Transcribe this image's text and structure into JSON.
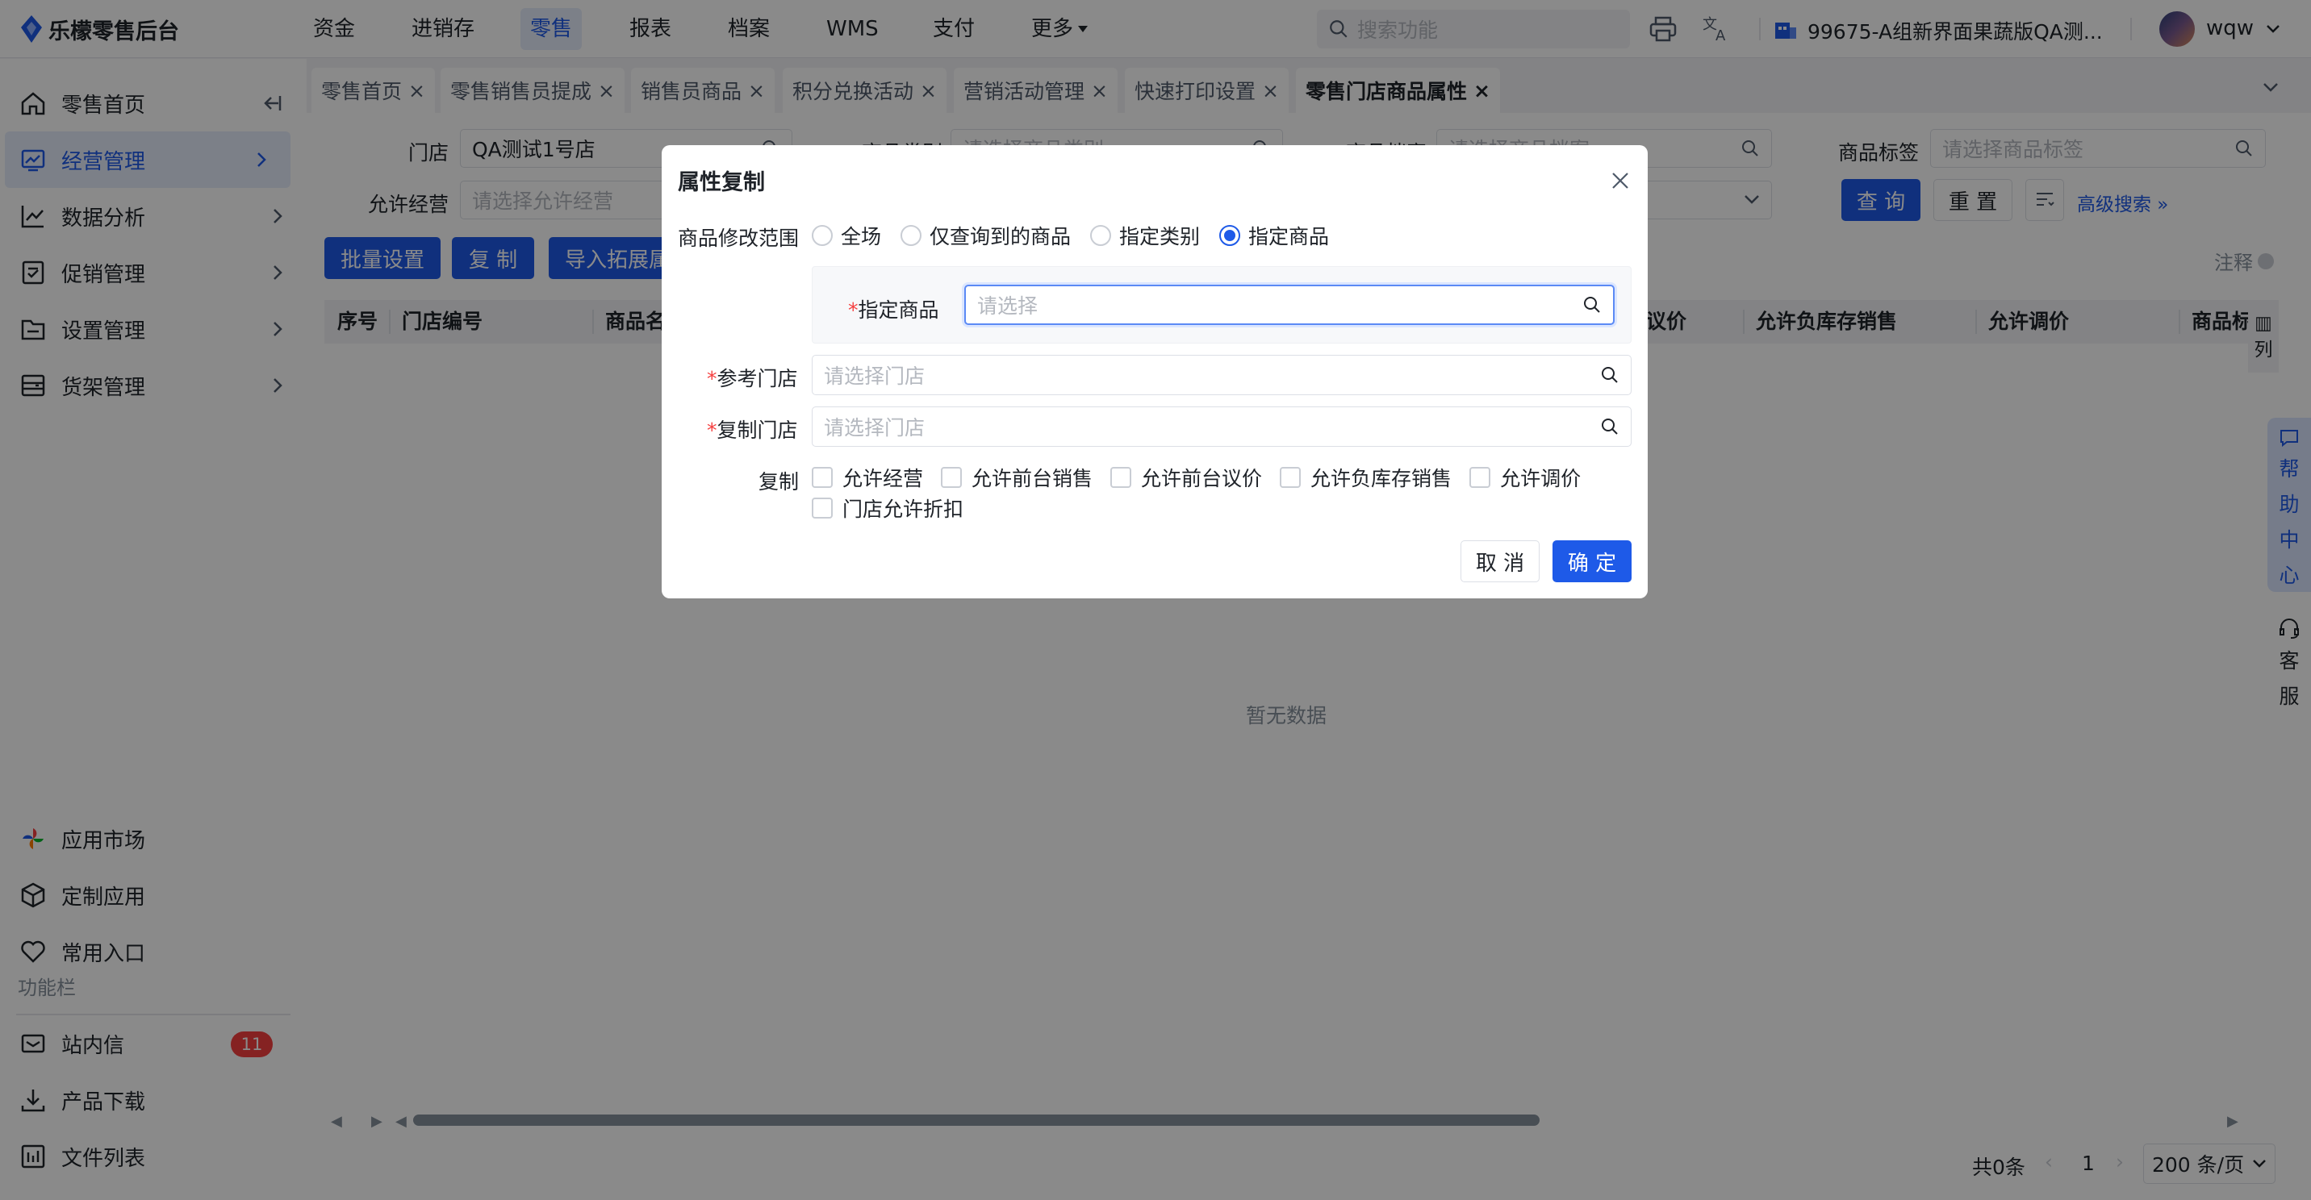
{
  "app": {
    "logo_text": "乐檬零售后台"
  },
  "topnav": {
    "items": [
      "资金",
      "进销存",
      "零售",
      "报表",
      "档案",
      "WMS",
      "支付",
      "更多"
    ],
    "active": "零售",
    "search_placeholder": "搜索功能",
    "store_name": "99675-A组新界面果蔬版QA测...",
    "username": "wqw"
  },
  "sidebar": {
    "items": [
      {
        "label": "零售首页",
        "icon": "home-icon"
      },
      {
        "label": "经营管理",
        "icon": "chart-board-icon"
      },
      {
        "label": "数据分析",
        "icon": "line-chart-icon"
      },
      {
        "label": "促销管理",
        "icon": "promotion-icon"
      },
      {
        "label": "设置管理",
        "icon": "folder-icon"
      },
      {
        "label": "货架管理",
        "icon": "shelf-icon"
      }
    ],
    "bottom_items": [
      {
        "label": "应用市场",
        "icon": "app-market-icon"
      },
      {
        "label": "定制应用",
        "icon": "cube-icon"
      },
      {
        "label": "常用入口",
        "icon": "heart-icon"
      }
    ],
    "section_label": "功能栏",
    "func_items": [
      {
        "label": "站内信",
        "icon": "mail-icon",
        "badge": "11"
      },
      {
        "label": "产品下载",
        "icon": "download-icon"
      },
      {
        "label": "文件列表",
        "icon": "file-list-icon"
      }
    ]
  },
  "tabs": [
    "零售首页",
    "零售销售员提成",
    "销售员商品",
    "积分兑换活动",
    "营销活动管理",
    "快速打印设置",
    "零售门店商品属性"
  ],
  "filters": {
    "store_label": "门店",
    "store_value": "QA测试1号店",
    "category_label": "商品类别",
    "category_placeholder": "请选择商品类别",
    "archive_label": "商品档案",
    "archive_placeholder": "请选择商品档案",
    "tag_label": "商品标签",
    "tag_placeholder": "请选择商品标签",
    "allow_label": "允许经营",
    "allow_placeholder": "请选择允许经营",
    "query_btn": "查 询",
    "reset_btn": "重 置",
    "advanced": "高级搜索"
  },
  "actions": {
    "batch": "批量设置",
    "copy": "复 制",
    "import": "导入拓展属性",
    "note": "注释"
  },
  "table": {
    "headers": [
      "序号",
      "门店编号",
      "商品名",
      "议价",
      "允许负库存销售",
      "允许调价",
      "商品标"
    ],
    "col_setting": "列",
    "empty": "暂无数据"
  },
  "pagination": {
    "total": "共0条",
    "page": "1",
    "page_size": "200 条/页"
  },
  "float": {
    "help": [
      "帮",
      "助",
      "中",
      "心"
    ],
    "service": [
      "客",
      "服"
    ]
  },
  "modal": {
    "title": "属性复制",
    "scope_label": "商品修改范围",
    "scope_options": [
      "全场",
      "仅查询到的商品",
      "指定类别",
      "指定商品"
    ],
    "scope_selected": "指定商品",
    "goods_label": "指定商品",
    "goods_placeholder": "请选择",
    "ref_store_label": "参考门店",
    "ref_store_placeholder": "请选择门店",
    "copy_store_label": "复制门店",
    "copy_store_placeholder": "请选择门店",
    "copy_label": "复制",
    "copy_options": [
      "允许经营",
      "允许前台销售",
      "允许前台议价",
      "允许负库存销售",
      "允许调价",
      "门店允许折扣"
    ],
    "cancel": "取 消",
    "ok": "确 定"
  },
  "colors": {
    "primary": "#1e5ae8",
    "badge": "#f53f3f"
  }
}
